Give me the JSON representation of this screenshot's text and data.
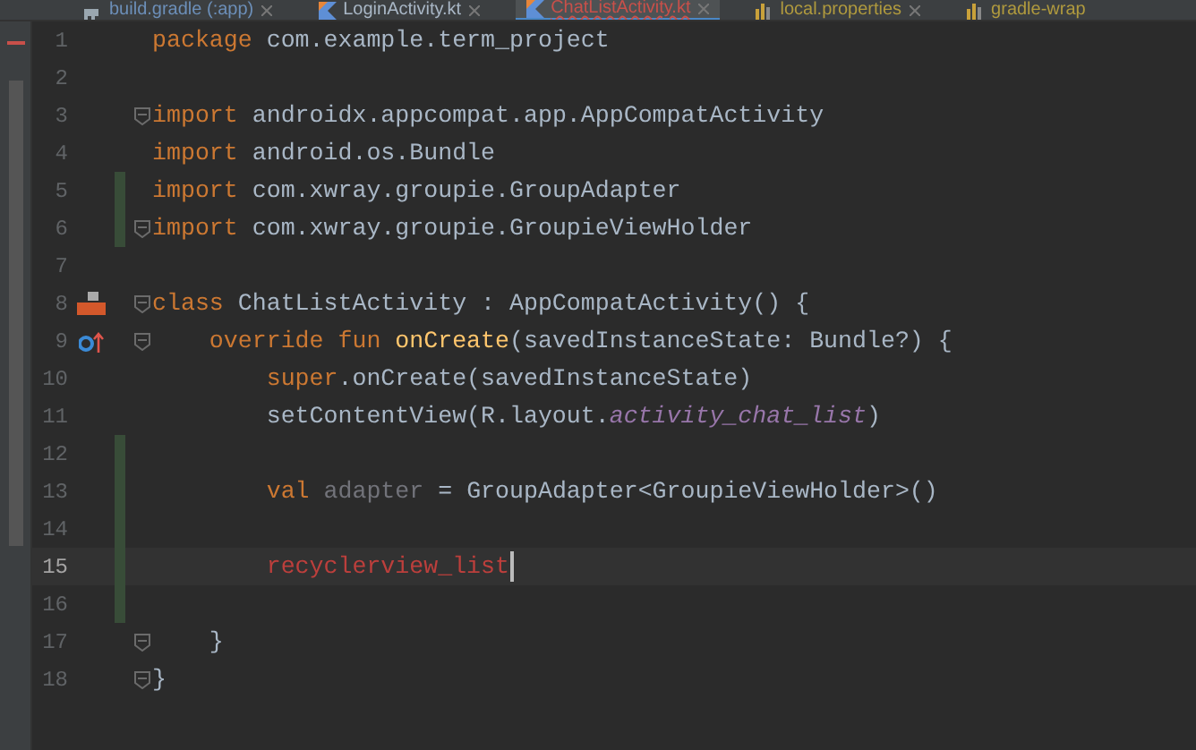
{
  "tabs": [
    {
      "label": "build.gradle (:app)",
      "kind": "gradle",
      "selected": false,
      "has_error": false,
      "closable": true
    },
    {
      "label": "LoginActivity.kt",
      "kind": "kotlin",
      "selected": false,
      "has_error": false,
      "closable": true
    },
    {
      "label": "ChatListActivity.kt",
      "kind": "kotlin",
      "selected": true,
      "has_error": true,
      "closable": true
    },
    {
      "label": "local.properties",
      "kind": "properties",
      "selected": false,
      "has_error": false,
      "closable": true
    },
    {
      "label": "gradle-wrap",
      "kind": "properties",
      "selected": false,
      "has_error": false,
      "closable": false
    }
  ],
  "lines": [
    {
      "number": "1",
      "kind": "code",
      "tokens": [
        {
          "text": "package",
          "kind": "keyword"
        },
        {
          "text": " com.example.term_project",
          "kind": "plain"
        }
      ]
    },
    {
      "number": "2",
      "kind": "code"
    },
    {
      "number": "3",
      "kind": "code",
      "fold": true,
      "tokens": [
        {
          "text": "import",
          "kind": "keyword"
        },
        {
          "text": " androidx.appcompat.app.AppCompatActivity",
          "kind": "plain"
        }
      ]
    },
    {
      "number": "4",
      "kind": "code",
      "tokens": [
        {
          "text": "import",
          "kind": "keyword"
        },
        {
          "text": " android.os.Bundle",
          "kind": "plain"
        }
      ]
    },
    {
      "number": "5",
      "kind": "code",
      "changed": true,
      "tokens": [
        {
          "text": "import",
          "kind": "keyword"
        },
        {
          "text": " com.xwray.groupie.GroupAdapter",
          "kind": "plain"
        }
      ]
    },
    {
      "number": "6",
      "kind": "code",
      "changed": true,
      "fold": true,
      "tokens": [
        {
          "text": "import",
          "kind": "keyword"
        },
        {
          "text": " com.xwray.groupie.GroupieViewHolder",
          "kind": "plain"
        }
      ]
    },
    {
      "number": "7",
      "kind": "code"
    },
    {
      "number": "8",
      "kind": "declaration",
      "fold": true,
      "tokens": [
        {
          "text": "class",
          "kind": "keyword"
        },
        {
          "text": " ChatListActivity : AppCompatActivity() {",
          "kind": "plain"
        }
      ]
    },
    {
      "number": "9",
      "kind": "override",
      "fold": true,
      "tokens": [
        {
          "text": "    override fun",
          "kind": "keyword"
        },
        {
          "text": " onCreate",
          "kind": "function"
        },
        {
          "text": "(savedInstanceState: Bundle?) {",
          "kind": "plain"
        }
      ]
    },
    {
      "number": "10",
      "kind": "code",
      "tokens": [
        {
          "text": "        super",
          "kind": "keyword"
        },
        {
          "text": ".onCreate(savedInstanceState)",
          "kind": "plain"
        }
      ]
    },
    {
      "number": "11",
      "kind": "code",
      "tokens": [
        {
          "text": "        setContentView(R.layout.",
          "kind": "plain"
        },
        {
          "text": "activity_chat_list",
          "kind": "italic"
        },
        {
          "text": ")",
          "kind": "plain"
        }
      ]
    },
    {
      "number": "12",
      "kind": "code",
      "changed": true
    },
    {
      "number": "13",
      "kind": "code",
      "changed": true,
      "tokens": [
        {
          "text": "        val",
          "kind": "keyword"
        },
        {
          "text": " adapter",
          "kind": "unused"
        },
        {
          "text": " = GroupAdapter<GroupieViewHolder>()",
          "kind": "plain"
        }
      ]
    },
    {
      "number": "14",
      "kind": "code",
      "changed": true
    },
    {
      "number": "15",
      "kind": "code",
      "changed": true,
      "current": true,
      "tokens": [
        {
          "text": "        recyclerview_list",
          "kind": "error"
        }
      ]
    },
    {
      "number": "16",
      "kind": "code",
      "changed": true
    },
    {
      "number": "17",
      "kind": "code",
      "fold": true,
      "tokens": [
        {
          "text": "    }",
          "kind": "plain"
        }
      ]
    },
    {
      "number": "18",
      "kind": "code",
      "fold": true,
      "tokens": [
        {
          "text": "}",
          "kind": "plain"
        }
      ]
    }
  ]
}
